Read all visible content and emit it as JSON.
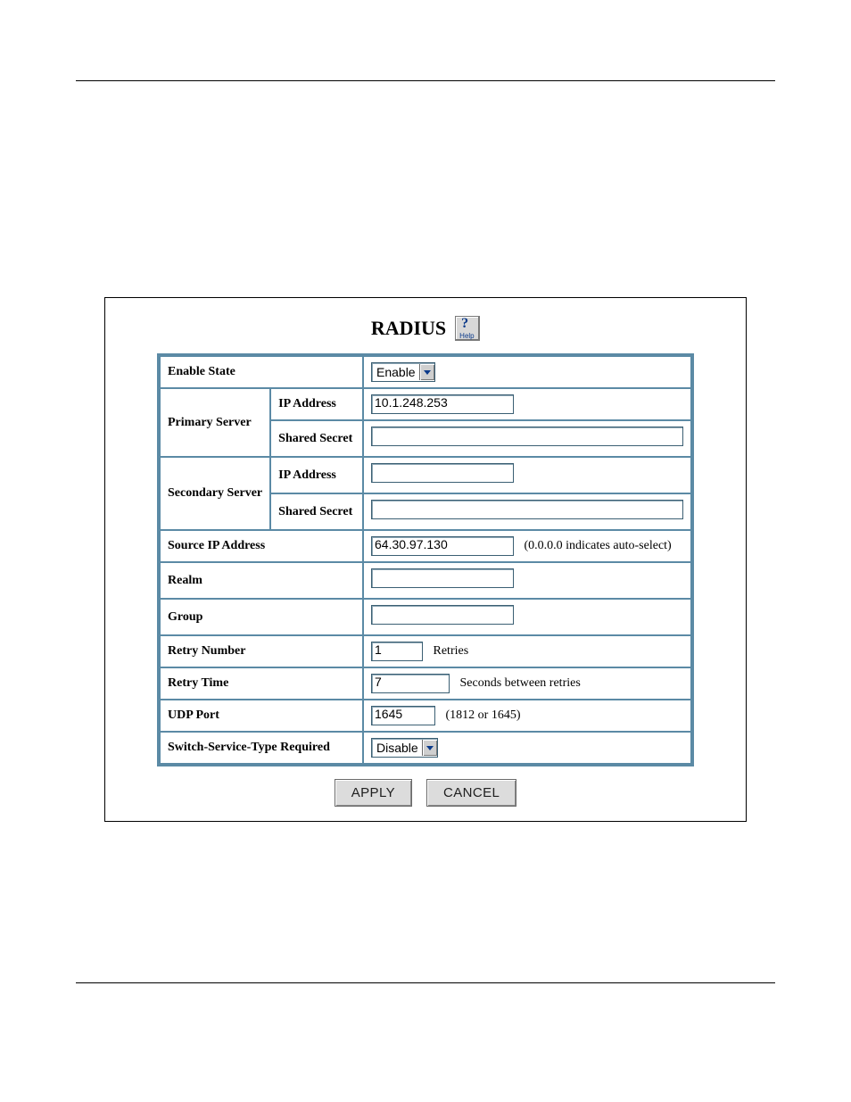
{
  "title": "RADIUS",
  "help_label": "Help",
  "labels": {
    "enable_state": "Enable State",
    "primary_server": "Primary Server",
    "secondary_server": "Secondary Server",
    "ip_address": "IP Address",
    "shared_secret": "Shared Secret",
    "source_ip_address": "Source IP Address",
    "realm": "Realm",
    "group": "Group",
    "retry_number": "Retry Number",
    "retry_time": "Retry Time",
    "udp_port": "UDP Port",
    "switch_service_type_required": "Switch-Service-Type Required"
  },
  "hints": {
    "source_ip": "(0.0.0.0 indicates auto-select)",
    "retries": "Retries",
    "seconds_between_retries": "Seconds between retries",
    "udp_port": "(1812 or 1645)"
  },
  "values": {
    "enable_state": "Enable",
    "primary_ip": "10.1.248.253",
    "primary_secret": "",
    "secondary_ip": "",
    "secondary_secret": "",
    "source_ip": "64.30.97.130",
    "realm": "",
    "group": "",
    "retry_number": "1",
    "retry_time": "7",
    "udp_port": "1645",
    "switch_service_type": "Disable"
  },
  "buttons": {
    "apply": "APPLY",
    "cancel": "CANCEL"
  }
}
